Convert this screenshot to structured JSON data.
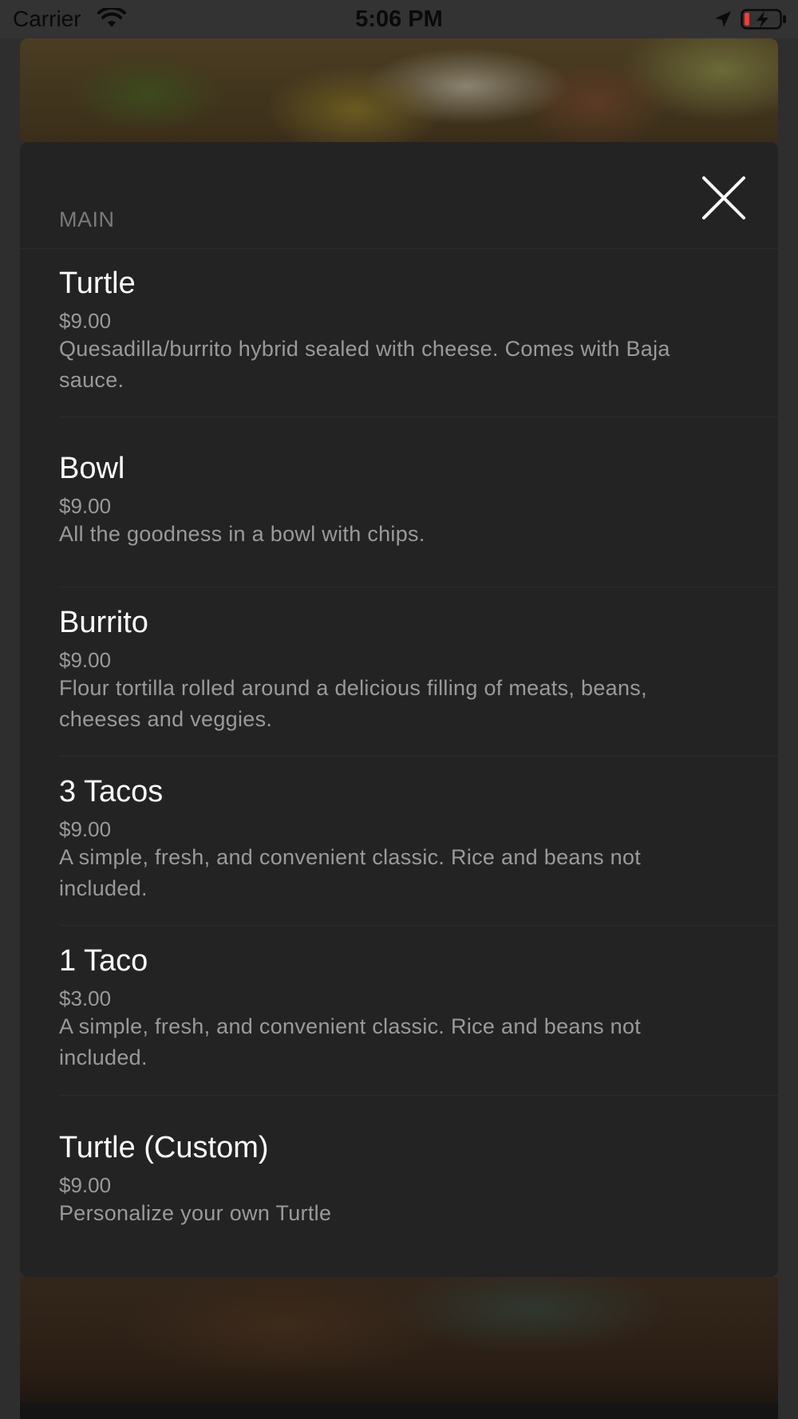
{
  "status_bar": {
    "carrier": "Carrier",
    "time": "5:06 PM",
    "icons": [
      "wifi-icon",
      "location-arrow-icon",
      "battery-low-charging-icon"
    ],
    "battery_color": "#ff3b30"
  },
  "modal": {
    "section_title": "MAIN",
    "close_icon": "close-icon",
    "items": [
      {
        "name": "Turtle",
        "price": "$9.00",
        "description": "Quesadilla/burrito hybrid sealed with cheese. Comes with Baja sauce."
      },
      {
        "name": "Bowl",
        "price": "$9.00",
        "description": "All the goodness in a bowl with chips."
      },
      {
        "name": "Burrito",
        "price": "$9.00",
        "description": "Flour tortilla rolled around a delicious filling of meats, beans, cheeses and veggies."
      },
      {
        "name": "3 Tacos",
        "price": "$9.00",
        "description": "A simple, fresh, and convenient classic. Rice and beans not included."
      },
      {
        "name": "1 Taco",
        "price": "$3.00",
        "description": "A simple, fresh, and convenient classic. Rice and beans not included."
      },
      {
        "name": "Turtle (Custom)",
        "price": "$9.00",
        "description": "Personalize your own Turtle"
      }
    ]
  },
  "colors": {
    "modal_background": "#232323",
    "page_background": "#2e2e2e",
    "item_name": "#ffffff",
    "secondary_text": "#9a9a9a"
  }
}
